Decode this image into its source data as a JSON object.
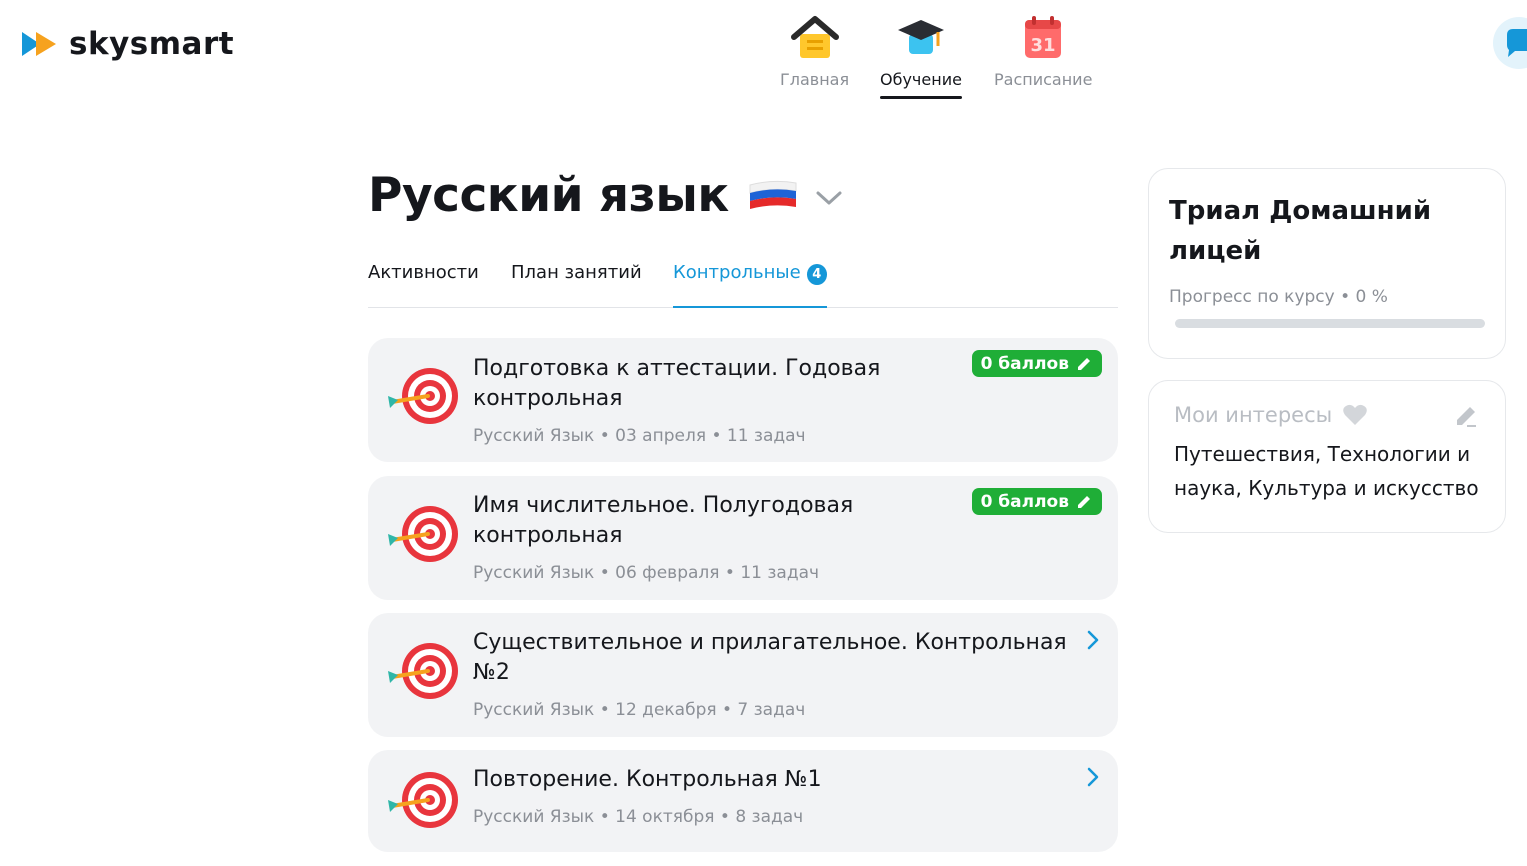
{
  "brand": {
    "name": "skysmart"
  },
  "nav": {
    "items": [
      {
        "label": "Главная",
        "icon": "house-icon"
      },
      {
        "label": "Обучение",
        "icon": "graduation-cap-icon",
        "active": true
      },
      {
        "label": "Расписание",
        "icon": "calendar-icon",
        "calendar_day": "31"
      }
    ]
  },
  "page": {
    "title": "Русский язык",
    "flag_icon": "russia-flag-icon"
  },
  "tabs": [
    {
      "label": "Активности"
    },
    {
      "label": "План занятий"
    },
    {
      "label": "Контрольные",
      "badge": "4",
      "active": true
    }
  ],
  "tests": [
    {
      "title": "Подготовка к аттестации. Годовая контрольная",
      "meta": "Русский Язык • 03 апреля • 11 задач",
      "score": "0 баллов",
      "icon": "target-icon"
    },
    {
      "title": "Имя числительное. Полугодовая контрольная",
      "meta": "Русский Язык • 06 февраля • 11 задач",
      "score": "0 баллов",
      "icon": "target-icon"
    },
    {
      "title": "Существительное и прилагательное. Контрольная №2",
      "meta": "Русский Язык • 12 декабря • 7 задач",
      "icon": "target-icon"
    },
    {
      "title": "Повторение. Контрольная №1",
      "meta": "Русский Язык • 14 октября • 8 задач",
      "icon": "target-icon"
    }
  ],
  "trial": {
    "title": "Триал Домашний лицей",
    "progress_label": "Прогресс по курсу • 0 %",
    "progress_value": 0
  },
  "interests": {
    "title": "Мои интересы",
    "text": "Путешествия, Технологии и наука, Культура и искусство"
  },
  "colors": {
    "accent": "#1597d8",
    "score_green": "#1fae37",
    "card_bg": "#f2f3f5",
    "muted": "#8b8f96"
  }
}
